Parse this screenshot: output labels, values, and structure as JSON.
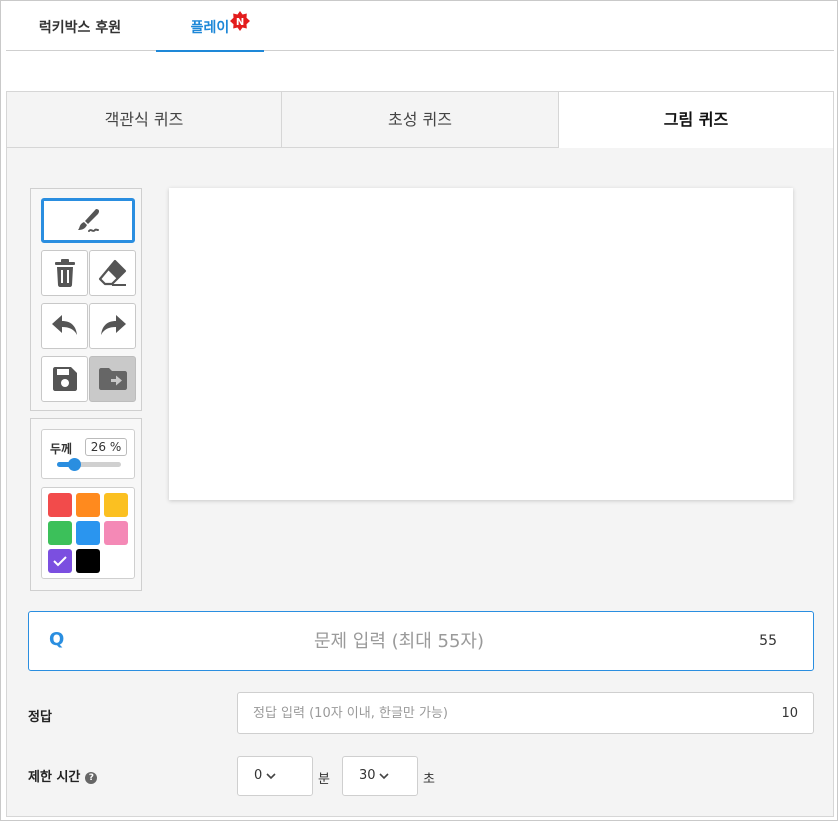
{
  "top_tabs": [
    {
      "label": "럭키박스 후원",
      "active": false
    },
    {
      "label": "플레이",
      "active": true,
      "badge": "N"
    }
  ],
  "quiz_tabs": [
    {
      "label": "객관식 퀴즈",
      "active": false
    },
    {
      "label": "초성 퀴즈",
      "active": false
    },
    {
      "label": "그림 퀴즈",
      "active": true
    }
  ],
  "toolbox": {
    "tools": [
      {
        "name": "pen",
        "icon": "brush-icon",
        "active": true
      },
      {
        "name": "clear",
        "icon": "trash-icon"
      },
      {
        "name": "eraser",
        "icon": "eraser-icon"
      },
      {
        "name": "undo",
        "icon": "undo-icon"
      },
      {
        "name": "redo",
        "icon": "redo-icon"
      },
      {
        "name": "save",
        "icon": "save-icon"
      },
      {
        "name": "load",
        "icon": "folder-load-icon",
        "disabled": true
      }
    ],
    "thickness": {
      "label": "두께",
      "value": 26,
      "display": "26 %"
    },
    "colors": [
      "#f24b4b",
      "#ff8a1e",
      "#fbc021",
      "#3cc05a",
      "#2a95ef",
      "#f489b6",
      "#7b4fe0",
      "#000000"
    ],
    "selected_color": "#7b4fe0"
  },
  "question": {
    "icon_label": "Q",
    "placeholder": "문제 입력 (최대 55자)",
    "value": "",
    "remaining": "55"
  },
  "answer": {
    "label": "정답",
    "placeholder": "정답 입력 (10자 이내, 한글만 가능)",
    "value": "",
    "remaining": "10"
  },
  "time_limit": {
    "label": "제한 시간",
    "help_icon": "?",
    "minutes": "0",
    "minutes_unit": "분",
    "seconds": "30",
    "seconds_unit": "초"
  }
}
